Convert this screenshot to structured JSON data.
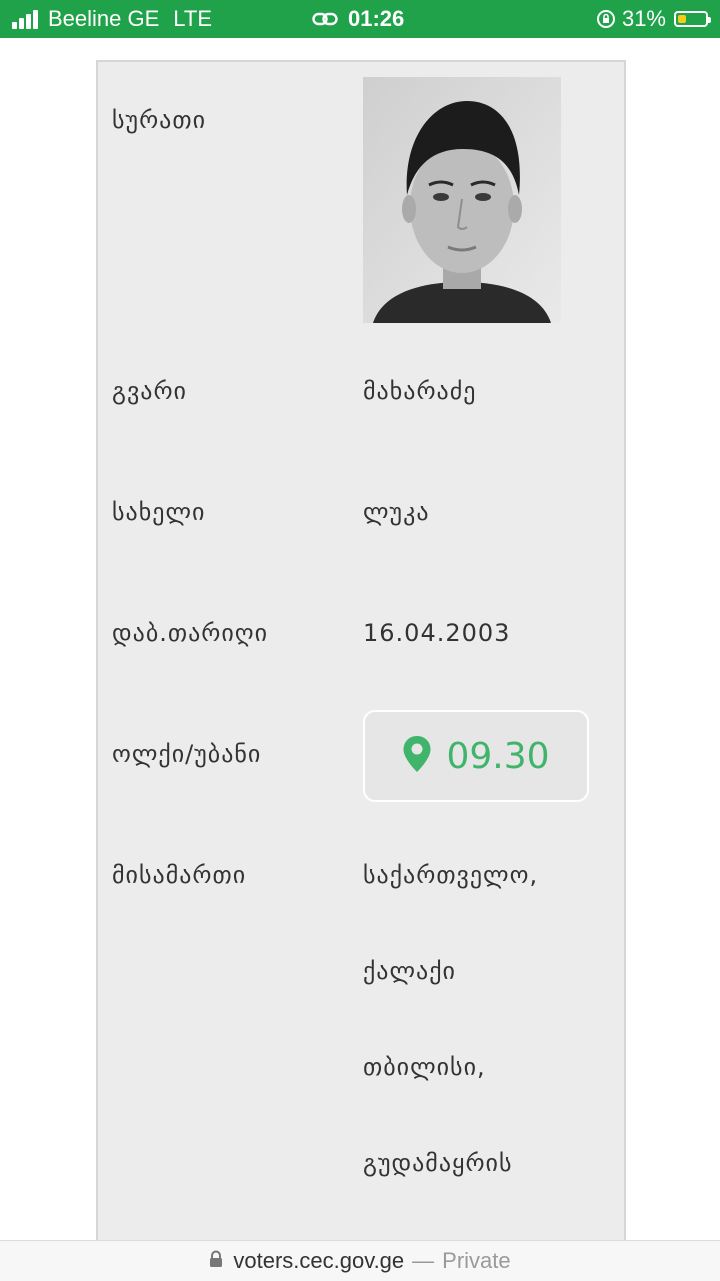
{
  "status_bar": {
    "carrier": "Beeline GE",
    "network": "LTE",
    "time": "01:26",
    "battery_percent": "31%",
    "battery_level": 0.31,
    "color": "#1fa24a"
  },
  "record": {
    "photo_label": "სურათი",
    "surname_label": "გვარი",
    "surname_value": "მახარაძე",
    "name_label": "სახელი",
    "name_value": "ლუკა",
    "dob_label": "დაბ.თარიღი",
    "dob_value": "16.04.2003",
    "precinct_label": "ოლქი/უბანი",
    "precinct_value": "09.30",
    "precinct_icon": "map-pin-icon",
    "precinct_color": "#3fb46a",
    "address_label": "მისამართი",
    "address_lines": [
      "საქართველო,",
      "ქალაქი",
      "თბილისი,",
      "გუდამაყრის"
    ]
  },
  "url_bar": {
    "host": "voters.cec.gov.ge",
    "separator": "—",
    "mode": "Private"
  }
}
